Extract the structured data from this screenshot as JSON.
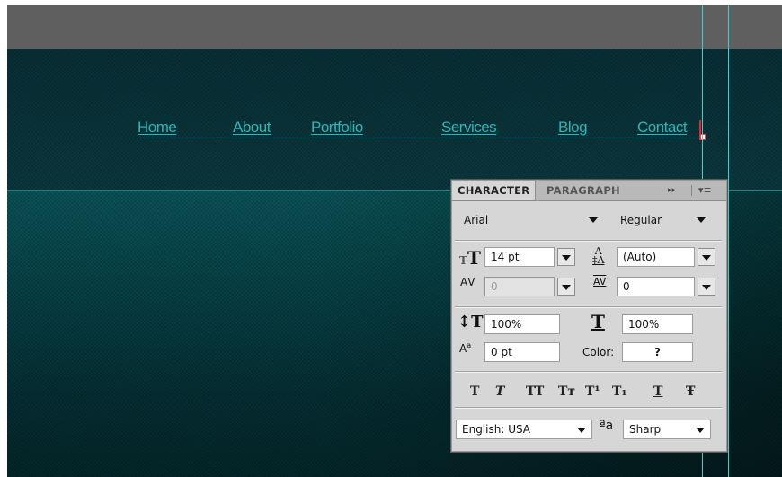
{
  "nav": {
    "items": [
      {
        "label": "Home"
      },
      {
        "label": "About"
      },
      {
        "label": "Portfolio"
      },
      {
        "label": "Services"
      },
      {
        "label": "Blog"
      },
      {
        "label": "Contact"
      }
    ]
  },
  "panel": {
    "tabs": {
      "character": "CHARACTER",
      "paragraph": "PARAGRAPH"
    },
    "collapse_label": "▸▸",
    "menu_label": "▾≡",
    "font_family": "Arial",
    "font_style": "Regular",
    "font_size": "14 pt",
    "leading": "(Auto)",
    "kerning": "0",
    "tracking": "0",
    "vertical_scale": "100%",
    "horizontal_scale": "100%",
    "baseline_shift": "0 pt",
    "color_label": "Color:",
    "color_value": "?",
    "style_buttons": {
      "bold": "T",
      "italic": "T",
      "all_caps": "TT",
      "small_caps": "Tт",
      "superscript": "T¹",
      "subscript": "T₁",
      "underline": "T",
      "strikethrough": "Ŧ"
    },
    "language": "English: USA",
    "aa_label": "ªa",
    "antialias": "Sharp"
  },
  "colors": {
    "nav_text": "#29b7bb",
    "guide": "#37d1d1",
    "topbar": "#5f5f5f",
    "panel_bg": "#d6d6d6"
  }
}
